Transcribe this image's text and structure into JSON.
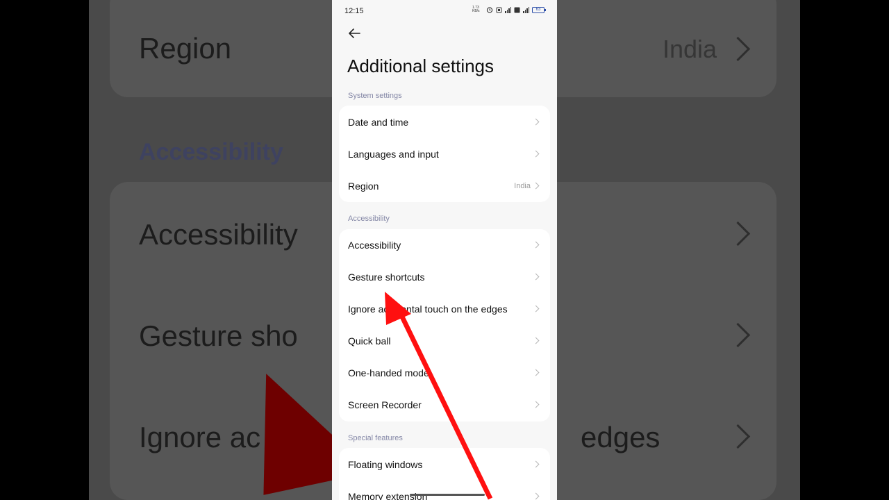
{
  "status_bar": {
    "time": "12:15",
    "net_speed": "1.73 KB/s",
    "battery": "63"
  },
  "page": {
    "title": "Additional settings"
  },
  "sections": [
    {
      "label": "System settings",
      "items": [
        {
          "label": "Date and time"
        },
        {
          "label": "Languages and input"
        },
        {
          "label": "Region",
          "value": "India"
        }
      ]
    },
    {
      "label": "Accessibility",
      "items": [
        {
          "label": "Accessibility"
        },
        {
          "label": "Gesture shortcuts"
        },
        {
          "label": "Ignore accidental touch on the edges"
        },
        {
          "label": "Quick ball"
        },
        {
          "label": "One-handed mode"
        },
        {
          "label": "Screen Recorder"
        }
      ]
    },
    {
      "label": "Special features",
      "items": [
        {
          "label": "Floating windows"
        },
        {
          "label": "Memory extension"
        }
      ]
    }
  ],
  "backdrop": {
    "region": "Region",
    "region_value": "India",
    "section": "Accessibility",
    "accessibility": "Accessibility",
    "gesture": "Gesture sho",
    "ignore": "Ignore ac",
    "edges": "edges"
  },
  "colors": {
    "accent_arrow": "#ff1010",
    "section_label": "#8487a6",
    "screen_bg": "#f7f7f7"
  }
}
